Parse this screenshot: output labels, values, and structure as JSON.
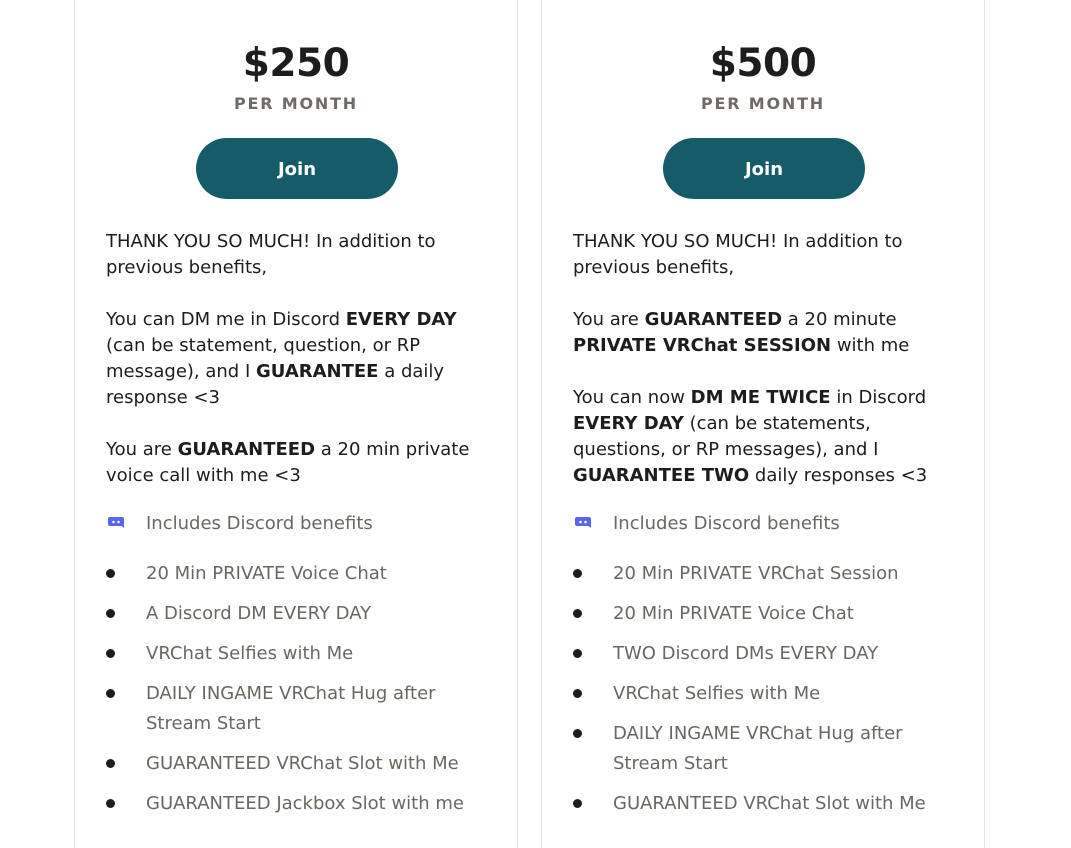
{
  "tiers": [
    {
      "price": "$250",
      "period": "PER MONTH",
      "join_label": "Join",
      "description": [
        [
          {
            "t": "THANK YOU SO MUCH! In addition to previous benefits,",
            "b": false
          }
        ],
        [
          {
            "t": "You can DM me in Discord ",
            "b": false
          },
          {
            "t": "EVERY DAY",
            "b": true
          },
          {
            "t": " (can be statement, question, or RP message), and I ",
            "b": false
          },
          {
            "t": "GUARANTEE",
            "b": true
          },
          {
            "t": " a daily response <3",
            "b": false
          }
        ],
        [
          {
            "t": "You are ",
            "b": false
          },
          {
            "t": "GUARANTEED",
            "b": true
          },
          {
            "t": " a 20 min private voice call with me <3",
            "b": false
          }
        ]
      ],
      "discord_label": "Includes Discord benefits",
      "benefits": [
        "20 Min PRIVATE Voice Chat",
        "A Discord DM EVERY DAY",
        "VRChat Selfies with Me",
        "DAILY INGAME VRChat Hug after Stream Start",
        "GUARANTEED VRChat Slot with Me",
        "GUARANTEED Jackbox Slot with me"
      ]
    },
    {
      "price": "$500",
      "period": "PER MONTH",
      "join_label": "Join",
      "description": [
        [
          {
            "t": "THANK YOU SO MUCH! In addition to previous benefits,",
            "b": false
          }
        ],
        [
          {
            "t": "You are ",
            "b": false
          },
          {
            "t": "GUARANTEED",
            "b": true
          },
          {
            "t": " a 20 minute ",
            "b": false
          },
          {
            "t": "PRIVATE VRChat SESSION",
            "b": true
          },
          {
            "t": " with me",
            "b": false
          }
        ],
        [
          {
            "t": "You can now ",
            "b": false
          },
          {
            "t": "DM ME TWICE",
            "b": true
          },
          {
            "t": " in Discord ",
            "b": false
          },
          {
            "t": "EVERY DAY",
            "b": true
          },
          {
            "t": " (can be statements, questions, or RP messages), and I ",
            "b": false
          },
          {
            "t": "GUARANTEE TWO",
            "b": true
          },
          {
            "t": " daily responses <3",
            "b": false
          }
        ]
      ],
      "discord_label": "Includes Discord benefits",
      "benefits": [
        "20 Min PRIVATE VRChat Session",
        "20 Min PRIVATE Voice Chat",
        "TWO Discord DMs EVERY DAY",
        "VRChat Selfies with Me",
        "DAILY INGAME VRChat Hug after Stream Start",
        "GUARANTEED VRChat Slot with Me"
      ]
    }
  ],
  "colors": {
    "accent": "#155b69",
    "discord": "#5865f2"
  },
  "icons": {
    "discord": "discord-icon",
    "bullet": "bullet-dot"
  }
}
